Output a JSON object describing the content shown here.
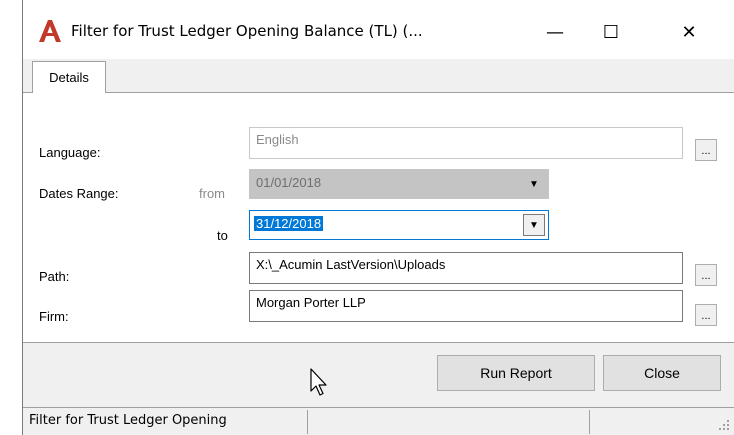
{
  "window": {
    "title": "Filter for Trust Ledger Opening Balance (TL) (...",
    "minimize_glyph": "—",
    "maximize_glyph": "☐",
    "close_glyph": "✕"
  },
  "tabs": [
    {
      "label": "Details",
      "active": true
    }
  ],
  "form": {
    "language": {
      "label": "Language:",
      "value": "English",
      "browse": "..."
    },
    "dates": {
      "label": "Dates Range:",
      "from_label": "from",
      "from_value": "01/01/2018",
      "to_label": "to",
      "to_value": "31/12/2018"
    },
    "path": {
      "label": "Path:",
      "value": "X:\\_Acumin LastVersion\\Uploads",
      "browse": "..."
    },
    "firm": {
      "label": "Firm:",
      "value": "Morgan Porter LLP",
      "browse": "..."
    }
  },
  "buttons": {
    "run_report": "Run Report",
    "close": "Close"
  },
  "status": {
    "text": "Filter for Trust Ledger Opening"
  },
  "colors": {
    "accent": "#0078d7",
    "logo": "#c0392b",
    "disabled_fill": "#c4c4c4"
  },
  "icons": {
    "logo": "acumin-logo-icon",
    "cursor": "mouse-pointer-icon",
    "grip": "resize-grip-icon"
  }
}
